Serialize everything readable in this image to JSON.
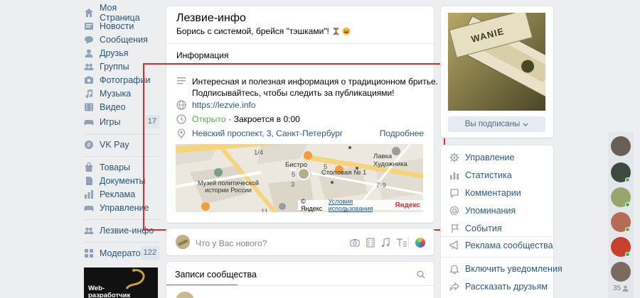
{
  "nav": {
    "items": [
      {
        "label": "Моя Страница",
        "icon": "home-icon"
      },
      {
        "label": "Новости",
        "icon": "news-icon"
      },
      {
        "label": "Сообщения",
        "icon": "messages-icon"
      },
      {
        "label": "Друзья",
        "icon": "friends-icon"
      },
      {
        "label": "Группы",
        "icon": "groups-icon"
      },
      {
        "label": "Фотографии",
        "icon": "photos-icon"
      },
      {
        "label": "Музыка",
        "icon": "music-icon"
      },
      {
        "label": "Видео",
        "icon": "video-icon"
      },
      {
        "label": "Игры",
        "icon": "games-icon",
        "count": "17"
      }
    ],
    "vkpay": "VK Pay",
    "extra": [
      {
        "label": "Товары",
        "icon": "goods-icon"
      },
      {
        "label": "Документы",
        "icon": "documents-icon"
      },
      {
        "label": "Реклама",
        "icon": "ads-icon"
      },
      {
        "label": "Управление",
        "icon": "manage-icon"
      }
    ],
    "group": "Лезвие-инфо",
    "moderator": {
      "label": "Модератор",
      "count": "122"
    },
    "ad_banner": "Web-разработчик на Python"
  },
  "group": {
    "name": "Лезвие-инфо",
    "status": "Борись с системой, брейся \"тэшками\"!",
    "info_tab": "Информация",
    "description_line1": "Интересная и полезная информация о традиционном бритье.",
    "description_line2": "Подписывайтесь, чтобы следить за публикациями!",
    "website": "https://lezvie.info",
    "open_status": "Открыто",
    "closes": "· Закроется в 0:00",
    "address": "Невский проспект, 3, Санкт-Петербург",
    "more_link": "Подробнее"
  },
  "map": {
    "labels": {
      "lavka": "Лавка Художника",
      "bistro": "Бистро",
      "stolovaya": "Столовая № 1",
      "museum_line1": "Музей политической",
      "museum_line2": "истории России",
      "n14": "1/4",
      "n5a": "5",
      "n5b": "5",
      "n3": "3",
      "n79": "7-9",
      "n11": "11",
      "n5c": "5"
    },
    "copyright": "© Яндекс",
    "terms": "Условия использования",
    "brand": "Яндекс"
  },
  "composer": {
    "placeholder": "Что у Вас нового?"
  },
  "wall": {
    "tab": "Записи сообщества"
  },
  "side": {
    "subscribed_button": "Вы подписаны",
    "cover_text": "WANIE",
    "menu": [
      {
        "label": "Управление",
        "icon": "gear-icon"
      },
      {
        "label": "Статистика",
        "icon": "stats-icon"
      },
      {
        "label": "Комментарии",
        "icon": "comments-icon"
      },
      {
        "label": "Упоминания",
        "icon": "at-icon"
      },
      {
        "label": "События",
        "icon": "events-icon"
      }
    ],
    "ads": "Реклама сообщества",
    "notify": "Включить уведомления",
    "share": "Рассказать друзьям"
  },
  "friends_online_count": "35",
  "colors": {
    "link": "#2a5885",
    "nav_link": "#285473",
    "accent_red": "#e12a2a",
    "open_green": "#4bb34b"
  }
}
